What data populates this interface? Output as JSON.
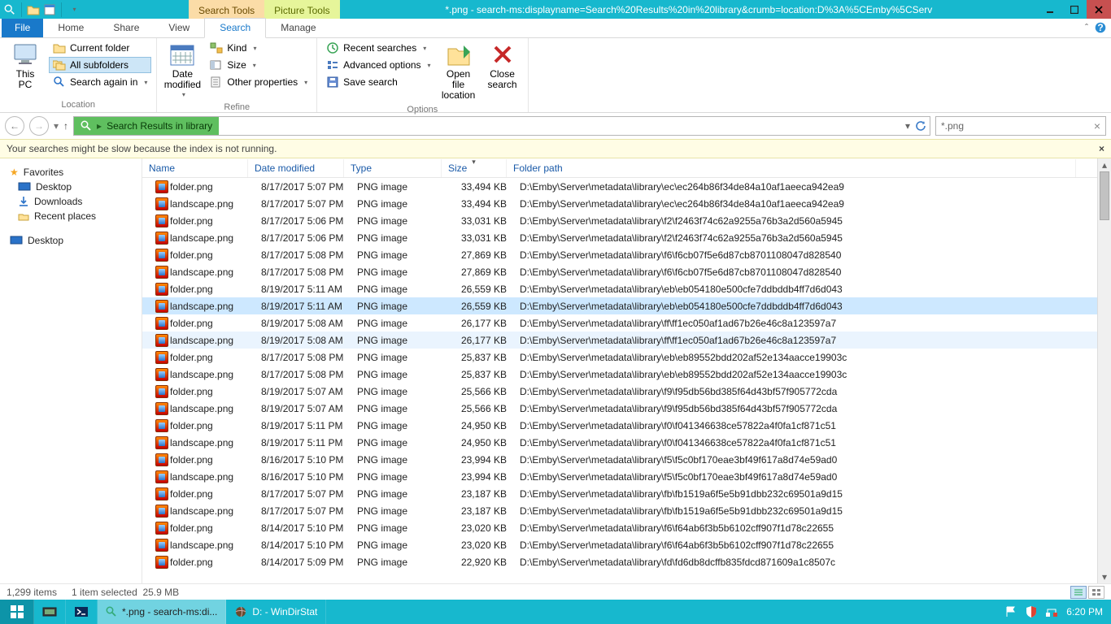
{
  "titlebar": {
    "title": "*.png - search-ms:displayname=Search%20Results%20in%20library&crumb=location:D%3A%5CEmby%5CServ",
    "context_tabs": {
      "search": "Search Tools",
      "picture": "Picture Tools"
    }
  },
  "tabs": {
    "file": "File",
    "home": "Home",
    "share": "Share",
    "view": "View",
    "search": "Search",
    "manage": "Manage"
  },
  "ribbon": {
    "this_pc": "This\nPC",
    "current_folder": "Current folder",
    "all_subfolders": "All subfolders",
    "search_again_in": "Search again in",
    "location": "Location",
    "date_modified": "Date\nmodified",
    "kind": "Kind",
    "size": "Size",
    "other_properties": "Other properties",
    "refine": "Refine",
    "recent_searches": "Recent searches",
    "advanced_options": "Advanced options",
    "save_search": "Save search",
    "options": "Options",
    "open_file_location": "Open file\nlocation",
    "close_search": "Close\nsearch"
  },
  "nav": {
    "breadcrumb": "Search Results in library",
    "search_value": "*.png"
  },
  "infobar": {
    "msg": "Your searches might be slow because the index is not running."
  },
  "navpane": {
    "favorites": "Favorites",
    "desktop": "Desktop",
    "downloads": "Downloads",
    "recent": "Recent places",
    "desktop2": "Desktop"
  },
  "columns": {
    "name": "Name",
    "date": "Date modified",
    "type": "Type",
    "size": "Size",
    "path": "Folder path"
  },
  "rows": [
    {
      "name": "folder.png",
      "date": "8/17/2017 5:07 PM",
      "type": "PNG image",
      "size": "33,494 KB",
      "path": "D:\\Emby\\Server\\metadata\\library\\ec\\ec264b86f34de84a10af1aeeca942ea9",
      "sel": false
    },
    {
      "name": "landscape.png",
      "date": "8/17/2017 5:07 PM",
      "type": "PNG image",
      "size": "33,494 KB",
      "path": "D:\\Emby\\Server\\metadata\\library\\ec\\ec264b86f34de84a10af1aeeca942ea9",
      "sel": false
    },
    {
      "name": "folder.png",
      "date": "8/17/2017 5:06 PM",
      "type": "PNG image",
      "size": "33,031 KB",
      "path": "D:\\Emby\\Server\\metadata\\library\\f2\\f2463f74c62a9255a76b3a2d560a5945",
      "sel": false
    },
    {
      "name": "landscape.png",
      "date": "8/17/2017 5:06 PM",
      "type": "PNG image",
      "size": "33,031 KB",
      "path": "D:\\Emby\\Server\\metadata\\library\\f2\\f2463f74c62a9255a76b3a2d560a5945",
      "sel": false
    },
    {
      "name": "folder.png",
      "date": "8/17/2017 5:08 PM",
      "type": "PNG image",
      "size": "27,869 KB",
      "path": "D:\\Emby\\Server\\metadata\\library\\f6\\f6cb07f5e6d87cb8701108047d828540",
      "sel": false
    },
    {
      "name": "landscape.png",
      "date": "8/17/2017 5:08 PM",
      "type": "PNG image",
      "size": "27,869 KB",
      "path": "D:\\Emby\\Server\\metadata\\library\\f6\\f6cb07f5e6d87cb8701108047d828540",
      "sel": false
    },
    {
      "name": "folder.png",
      "date": "8/19/2017 5:11 AM",
      "type": "PNG image",
      "size": "26,559 KB",
      "path": "D:\\Emby\\Server\\metadata\\library\\eb\\eb054180e500cfe7ddbddb4ff7d6d043",
      "sel": false
    },
    {
      "name": "landscape.png",
      "date": "8/19/2017 5:11 AM",
      "type": "PNG image",
      "size": "26,559 KB",
      "path": "D:\\Emby\\Server\\metadata\\library\\eb\\eb054180e500cfe7ddbddb4ff7d6d043",
      "sel": true
    },
    {
      "name": "folder.png",
      "date": "8/19/2017 5:08 AM",
      "type": "PNG image",
      "size": "26,177 KB",
      "path": "D:\\Emby\\Server\\metadata\\library\\ff\\ff1ec050af1ad67b26e46c8a123597a7",
      "sel": false
    },
    {
      "name": "landscape.png",
      "date": "8/19/2017 5:08 AM",
      "type": "PNG image",
      "size": "26,177 KB",
      "path": "D:\\Emby\\Server\\metadata\\library\\ff\\ff1ec050af1ad67b26e46c8a123597a7",
      "sel": false,
      "hov": true
    },
    {
      "name": "folder.png",
      "date": "8/17/2017 5:08 PM",
      "type": "PNG image",
      "size": "25,837 KB",
      "path": "D:\\Emby\\Server\\metadata\\library\\eb\\eb89552bdd202af52e134aacce19903c",
      "sel": false
    },
    {
      "name": "landscape.png",
      "date": "8/17/2017 5:08 PM",
      "type": "PNG image",
      "size": "25,837 KB",
      "path": "D:\\Emby\\Server\\metadata\\library\\eb\\eb89552bdd202af52e134aacce19903c",
      "sel": false
    },
    {
      "name": "folder.png",
      "date": "8/19/2017 5:07 AM",
      "type": "PNG image",
      "size": "25,566 KB",
      "path": "D:\\Emby\\Server\\metadata\\library\\f9\\f95db56bd385f64d43bf57f905772cda",
      "sel": false
    },
    {
      "name": "landscape.png",
      "date": "8/19/2017 5:07 AM",
      "type": "PNG image",
      "size": "25,566 KB",
      "path": "D:\\Emby\\Server\\metadata\\library\\f9\\f95db56bd385f64d43bf57f905772cda",
      "sel": false
    },
    {
      "name": "folder.png",
      "date": "8/19/2017 5:11 PM",
      "type": "PNG image",
      "size": "24,950 KB",
      "path": "D:\\Emby\\Server\\metadata\\library\\f0\\f041346638ce57822a4f0fa1cf871c51",
      "sel": false
    },
    {
      "name": "landscape.png",
      "date": "8/19/2017 5:11 PM",
      "type": "PNG image",
      "size": "24,950 KB",
      "path": "D:\\Emby\\Server\\metadata\\library\\f0\\f041346638ce57822a4f0fa1cf871c51",
      "sel": false
    },
    {
      "name": "folder.png",
      "date": "8/16/2017 5:10 PM",
      "type": "PNG image",
      "size": "23,994 KB",
      "path": "D:\\Emby\\Server\\metadata\\library\\f5\\f5c0bf170eae3bf49f617a8d74e59ad0",
      "sel": false
    },
    {
      "name": "landscape.png",
      "date": "8/16/2017 5:10 PM",
      "type": "PNG image",
      "size": "23,994 KB",
      "path": "D:\\Emby\\Server\\metadata\\library\\f5\\f5c0bf170eae3bf49f617a8d74e59ad0",
      "sel": false
    },
    {
      "name": "folder.png",
      "date": "8/17/2017 5:07 PM",
      "type": "PNG image",
      "size": "23,187 KB",
      "path": "D:\\Emby\\Server\\metadata\\library\\fb\\fb1519a6f5e5b91dbb232c69501a9d15",
      "sel": false
    },
    {
      "name": "landscape.png",
      "date": "8/17/2017 5:07 PM",
      "type": "PNG image",
      "size": "23,187 KB",
      "path": "D:\\Emby\\Server\\metadata\\library\\fb\\fb1519a6f5e5b91dbb232c69501a9d15",
      "sel": false
    },
    {
      "name": "folder.png",
      "date": "8/14/2017 5:10 PM",
      "type": "PNG image",
      "size": "23,020 KB",
      "path": "D:\\Emby\\Server\\metadata\\library\\f6\\f64ab6f3b5b6102cff907f1d78c22655",
      "sel": false
    },
    {
      "name": "landscape.png",
      "date": "8/14/2017 5:10 PM",
      "type": "PNG image",
      "size": "23,020 KB",
      "path": "D:\\Emby\\Server\\metadata\\library\\f6\\f64ab6f3b5b6102cff907f1d78c22655",
      "sel": false
    },
    {
      "name": "folder.png",
      "date": "8/14/2017 5:09 PM",
      "type": "PNG image",
      "size": "22,920 KB",
      "path": "D:\\Emby\\Server\\metadata\\library\\fd\\fd6db8dcffb835fdcd871609a1c8507c",
      "sel": false
    }
  ],
  "status": {
    "items": "1,299 items",
    "selected": "1 item selected",
    "size": "25.9 MB"
  },
  "taskbar": {
    "task1": "*.png - search-ms:di...",
    "task2": "D: - WinDirStat",
    "clock": "6:20 PM"
  }
}
